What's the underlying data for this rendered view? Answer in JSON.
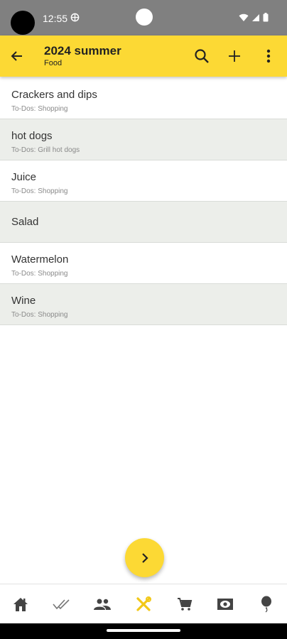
{
  "status_bar": {
    "time": "12:55"
  },
  "app_bar": {
    "title": "2024 summer",
    "subtitle": "Food"
  },
  "items": [
    {
      "title": "Crackers and dips",
      "subtitle": "To-Dos: Shopping"
    },
    {
      "title": "hot dogs",
      "subtitle": "To-Dos: Grill hot dogs"
    },
    {
      "title": "Juice",
      "subtitle": "To-Dos: Shopping"
    },
    {
      "title": "Salad",
      "subtitle": ""
    },
    {
      "title": "Watermelon",
      "subtitle": "To-Dos: Shopping"
    },
    {
      "title": "Wine",
      "subtitle": "To-Dos: Shopping"
    }
  ],
  "colors": {
    "accent": "#fcd934",
    "alt_row": "#eceeea",
    "status_bar": "#808080"
  },
  "icons": {
    "app_bar": [
      "back-arrow-icon",
      "search-icon",
      "plus-icon",
      "more-vert-icon"
    ],
    "bottom_nav": [
      "home-icon",
      "double-check-icon",
      "people-icon",
      "tools-icon",
      "cart-icon",
      "money-icon",
      "balloon-icon"
    ],
    "fab": "chevron-right-icon"
  }
}
